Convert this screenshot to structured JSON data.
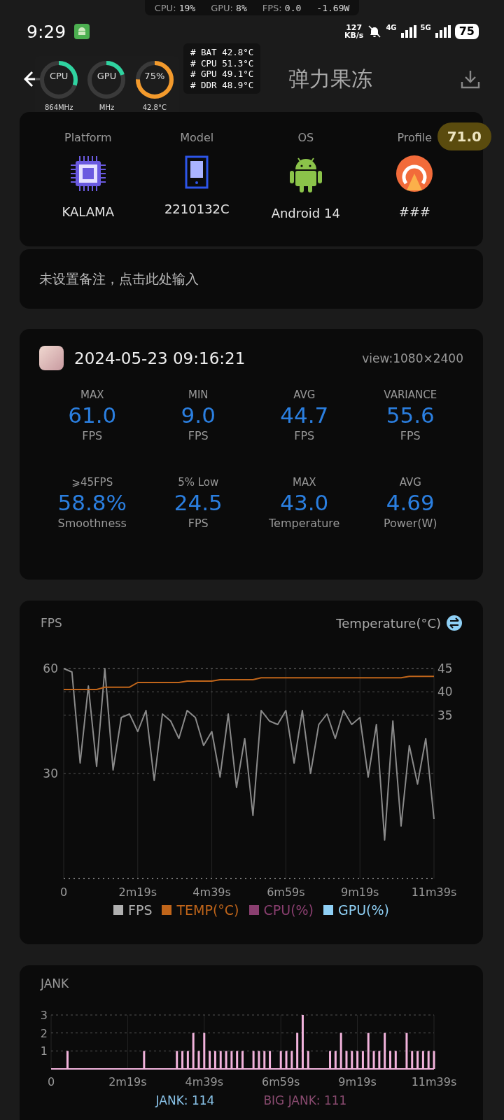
{
  "overlay_bar": {
    "items": [
      {
        "label": "CPU:",
        "value": "19%"
      },
      {
        "label": "GPU:",
        "value": "8%"
      },
      {
        "label": "FPS:",
        "value": "0.0"
      }
    ],
    "power": "-1.69W"
  },
  "status_bar": {
    "time": "9:29",
    "net_speed_value": "127",
    "net_speed_unit": "KB/s",
    "networks": [
      "4G",
      "5G"
    ],
    "battery": "75"
  },
  "header": {
    "title": "弹力果冻"
  },
  "monitor": {
    "rings": [
      {
        "label": "CPU",
        "caption": "864MHz",
        "level": 0.3,
        "color": "#2fd3a0"
      },
      {
        "label": "GPU",
        "caption": "MHz",
        "level": 0.2,
        "color": "#2fd3a0"
      },
      {
        "label": "75%",
        "caption": "42.8°C",
        "level": 0.75,
        "color": "#f39a2c"
      }
    ],
    "temps": [
      "# BAT 42.8°C",
      "# CPU 51.3°C",
      "# GPU 49.1°C",
      "# DDR 48.9°C"
    ]
  },
  "device": {
    "items": [
      {
        "kind": "chip",
        "label": "Platform",
        "value": "KALAMA"
      },
      {
        "kind": "phone",
        "label": "Model",
        "value": "2210132C"
      },
      {
        "kind": "android",
        "label": "OS",
        "value": "Android 14"
      },
      {
        "kind": "profile",
        "label": "Profile",
        "value": "###"
      }
    ],
    "score": "71.0"
  },
  "note": {
    "placeholder": "未设置备注，点击此处输入"
  },
  "session": {
    "date": "2024-05-23 09:16:21",
    "view": "view:1080×2400",
    "stats": [
      {
        "label": "MAX",
        "value": "61.0",
        "unit": "FPS"
      },
      {
        "label": "MIN",
        "value": "9.0",
        "unit": "FPS"
      },
      {
        "label": "AVG",
        "value": "44.7",
        "unit": "FPS"
      },
      {
        "label": "VARIANCE",
        "value": "55.6",
        "unit": "FPS"
      },
      {
        "label": "⩾45FPS",
        "value": "58.8%",
        "unit": "Smoothness"
      },
      {
        "label": "5% Low",
        "value": "24.5",
        "unit": "FPS"
      },
      {
        "label": "MAX",
        "value": "43.0",
        "unit": "Temperature"
      },
      {
        "label": "AVG",
        "value": "4.69",
        "unit": "Power(W)"
      }
    ]
  },
  "fps_chart": {
    "title": "FPS",
    "right_title": "Temperature(°C)",
    "chart_data": {
      "type": "line",
      "categories": [
        "0",
        null,
        null,
        null,
        null,
        null,
        null,
        null,
        null,
        "2m19s",
        null,
        null,
        null,
        null,
        null,
        null,
        null,
        null,
        "4m39s",
        null,
        null,
        null,
        null,
        null,
        null,
        null,
        null,
        "6m59s",
        null,
        null,
        null,
        null,
        null,
        null,
        null,
        null,
        "9m19s",
        null,
        null,
        null,
        null,
        null,
        null,
        null,
        null,
        "11m39s"
      ],
      "series": [
        {
          "name": "FPS",
          "color": "#8a8a8a",
          "values": [
            60,
            59,
            33,
            55,
            32,
            60,
            31,
            46,
            47,
            42,
            48,
            28,
            47,
            45,
            40,
            48,
            46,
            38,
            42,
            29,
            47,
            26,
            40,
            18,
            48,
            45,
            44,
            48,
            33,
            48,
            30,
            44,
            47,
            40,
            48,
            44,
            46,
            29,
            44,
            11,
            45,
            15,
            38,
            27,
            40,
            17
          ]
        },
        {
          "name": "TEMP(°C)",
          "color": "#c0651a",
          "axis": "y2",
          "values": [
            40.5,
            40.5,
            40.5,
            40.5,
            40.5,
            41,
            41,
            41,
            41,
            42,
            42,
            42,
            42,
            42,
            42,
            42.3,
            42.3,
            42.3,
            42.3,
            42.6,
            42.6,
            42.6,
            42.6,
            42.6,
            43,
            43,
            43,
            43,
            43,
            43,
            43,
            43,
            43,
            43,
            43,
            43,
            43,
            43,
            43,
            43,
            43,
            43,
            43.3,
            43.3,
            43.3,
            43.3
          ]
        }
      ],
      "ylim": [
        0,
        60
      ],
      "y2lim": [
        0,
        45
      ],
      "grid": true,
      "yticks": [
        30,
        60
      ],
      "y2ticks": [
        35,
        40,
        45
      ]
    },
    "legend": [
      {
        "label": "CPU(%)",
        "color": "#8a3f70"
      },
      {
        "label": "GPU(%)",
        "color": "#8fd0f5"
      }
    ]
  },
  "jank_chart": {
    "title": "JANK",
    "chart_data": {
      "type": "bar",
      "categories": [
        "0",
        null,
        null,
        null,
        null,
        null,
        null,
        null,
        null,
        null,
        null,
        null,
        null,
        null,
        "2m19s",
        null,
        null,
        null,
        null,
        null,
        null,
        null,
        null,
        null,
        null,
        null,
        null,
        null,
        "4m39s",
        null,
        null,
        null,
        null,
        null,
        null,
        null,
        null,
        null,
        null,
        null,
        null,
        null,
        "6m59s",
        null,
        null,
        null,
        null,
        null,
        null,
        null,
        null,
        null,
        null,
        null,
        null,
        null,
        "9m19s",
        null,
        null,
        null,
        null,
        null,
        null,
        null,
        null,
        null,
        null,
        null,
        null,
        null,
        "11m39s"
      ],
      "values": [
        0,
        0,
        0,
        1,
        0,
        0,
        0,
        0,
        0,
        0,
        0,
        0,
        0,
        0,
        0,
        0,
        0,
        1,
        0,
        0,
        0,
        0,
        0,
        1,
        1,
        1,
        2,
        1,
        2,
        1,
        1,
        1,
        1,
        1,
        1,
        1,
        0,
        1,
        1,
        1,
        1,
        0,
        1,
        1,
        1,
        2,
        3,
        1,
        0,
        0,
        0,
        1,
        1,
        2,
        1,
        1,
        1,
        1,
        2,
        1,
        1,
        2,
        1,
        1,
        0,
        2,
        1,
        1,
        1,
        1,
        1
      ],
      "ylim": [
        0,
        3
      ],
      "grid": true,
      "yticks": [
        1,
        2,
        3
      ],
      "color": "#f2b3dc"
    },
    "legend": [
      {
        "label": "JANK: 114",
        "color": "#8ac4ea"
      },
      {
        "label": "BIG JANK: 111",
        "color": "#8a4b70"
      }
    ]
  }
}
